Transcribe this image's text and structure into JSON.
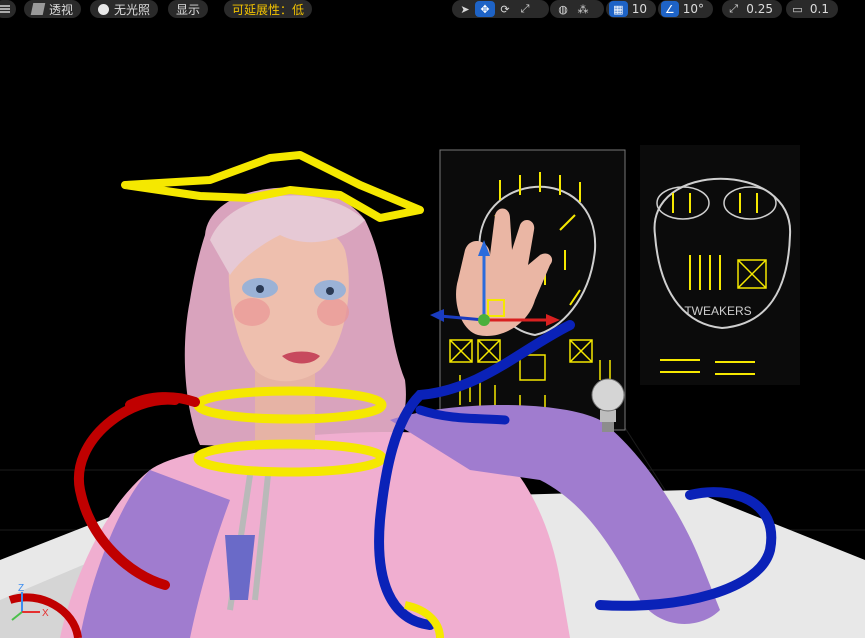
{
  "toolbar": {
    "view_mode_label": "透视",
    "lighting_label": "无光照",
    "show_label": "显示",
    "scalability_label": "可延展性：低",
    "grid_snap_value": "10",
    "rotation_snap_value": "10°",
    "scale_snap_value": "0.25",
    "camera_speed_value": "0.1"
  },
  "scene": {
    "face_board_label": "TWEAKERS",
    "axis_labels": {
      "x": "X",
      "z": "Z"
    }
  },
  "colors": {
    "toolbar_bg": "#2a2a2a",
    "active_blue": "#1e63c6",
    "accent_yellow": "#f2c200",
    "control_yellow": "#f5e800",
    "control_red": "#c00000",
    "control_blue": "#0a22b8"
  },
  "icons": {
    "select": "cursor-arrow-icon",
    "translate": "move-arrows-icon",
    "rotate": "rotate-icon",
    "scale": "scale-icon",
    "world": "globe-icon",
    "surface": "surface-snap-icon",
    "grid": "grid-icon",
    "angle": "angle-icon",
    "scale_snap": "scale-snap-icon",
    "camera": "camera-icon",
    "light": "light-bulb-icon"
  }
}
